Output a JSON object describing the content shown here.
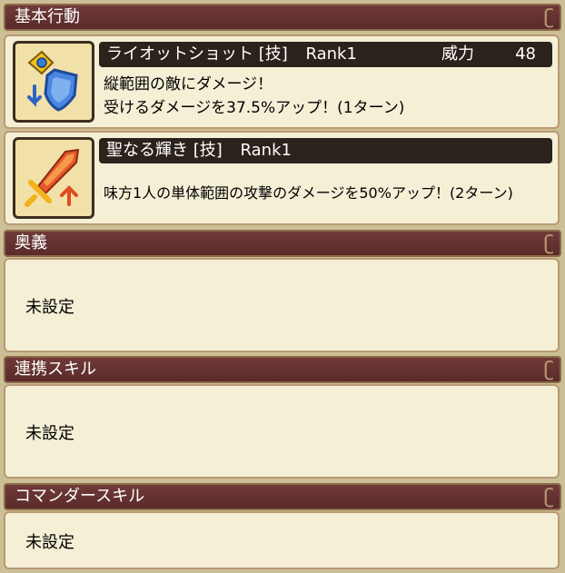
{
  "sections": {
    "basic": {
      "title": "基本行動"
    },
    "ougi": {
      "title": "奥義",
      "value": "未設定"
    },
    "renkei": {
      "title": "連携スキル",
      "value": "未設定"
    },
    "commander": {
      "title": "コマンダースキル",
      "value": "未設定"
    }
  },
  "skills": [
    {
      "name": "ライオットショット [技]",
      "rank": "Rank1",
      "power_label": "威力",
      "power_value": "48",
      "desc_line1": "縦範囲の敵にダメージ！",
      "desc_line2": "受けるダメージを37.5%アップ！(1ターン)",
      "icon": "shield-down-icon"
    },
    {
      "name": "聖なる輝き [技]",
      "rank": "Rank1",
      "desc_line1": "味方1人の単体範囲の攻撃のダメージを50%アップ！(2ターン)",
      "icon": "sword-up-icon"
    }
  ],
  "colors": {
    "header_bg": "#5a2b2a",
    "panel_bg": "#f5efd6",
    "titlebar_bg": "#2c221c",
    "background": "#cdbf95"
  }
}
